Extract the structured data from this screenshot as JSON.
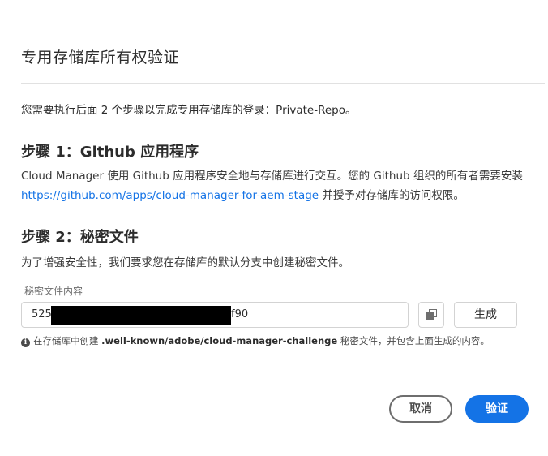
{
  "dialog": {
    "title": "专用存储库所有权验证",
    "intro": "您需要执行后面 2 个步骤以完成专用存储库的登录：Private-Repo。"
  },
  "step1": {
    "heading": "步骤 1：Github 应用程序",
    "desc_part1": "Cloud Manager 使用 Github 应用程序安全地与存储库进行交互。您的 Github 组织的所有者需要安装 ",
    "link": "https://github.com/apps/cloud-manager-for-aem-stage",
    "desc_part2": " 并授予对存储库的访问权限。"
  },
  "step2": {
    "heading": "步骤 2：秘密文件",
    "desc": "为了增强安全性，我们要求您在存储库的默认分支中创建秘密文件。",
    "field_label": "秘密文件内容",
    "secret_prefix": "525",
    "secret_suffix": "f90",
    "copy_icon": "copy-icon",
    "generate_label": "生成",
    "help_before": "在存储库中创建 ",
    "help_path": ".well-known/adobe/cloud-manager-challenge",
    "help_after": " 秘密文件，并包含上面生成的内容。",
    "info_icon_glyph": "i"
  },
  "footer": {
    "cancel_label": "取消",
    "verify_label": "验证"
  },
  "colors": {
    "accent": "#1473e6",
    "text": "#2c2c2c",
    "border": "#d3d3d3"
  }
}
